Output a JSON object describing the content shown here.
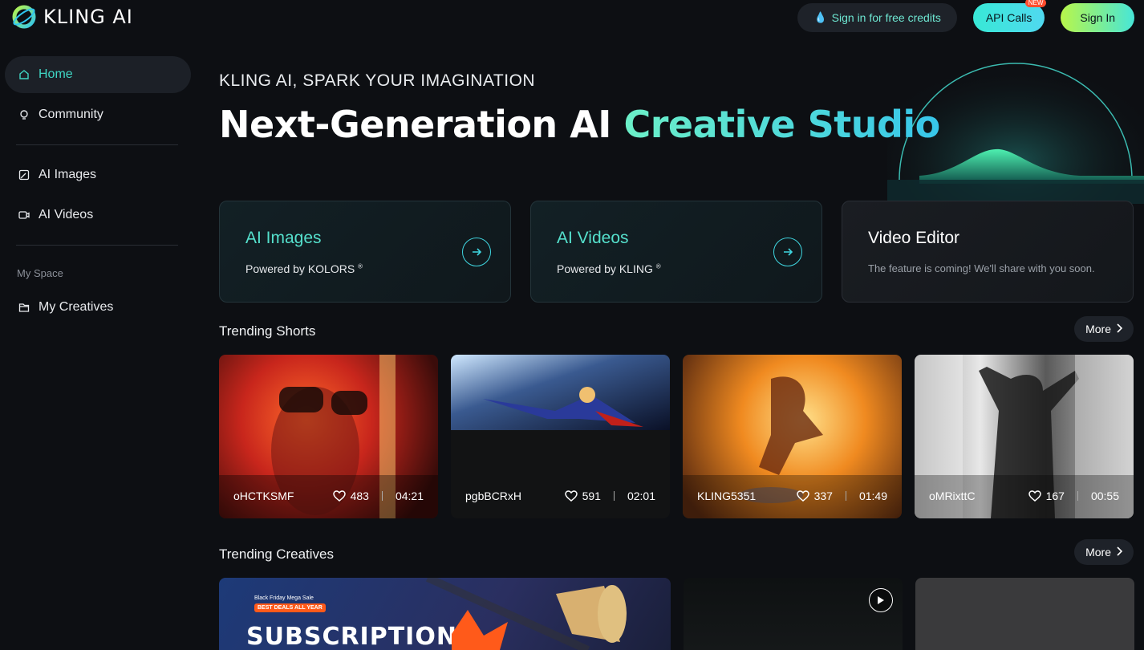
{
  "brand": {
    "name": "KLING AI",
    "accent": "#3fd6c4"
  },
  "header": {
    "credits_label": "Sign in for free credits",
    "api_label": "API Calls",
    "api_badge": "NEW",
    "signin_label": "Sign In"
  },
  "sidebar": {
    "items": [
      {
        "label": "Home",
        "icon": "home-icon",
        "active": true
      },
      {
        "label": "Community",
        "icon": "bulb-icon"
      },
      {
        "label": "AI Images",
        "icon": "image-icon"
      },
      {
        "label": "AI Videos",
        "icon": "video-icon"
      }
    ],
    "section_label": "My Space",
    "my_creatives": {
      "label": "My Creatives",
      "icon": "folder-icon"
    }
  },
  "hero": {
    "subtitle": "KLING AI, SPARK YOUR IMAGINATION",
    "title_plain": "Next-Generation AI ",
    "title_highlight": "Creative Studio"
  },
  "cards": [
    {
      "title": "AI Images",
      "subtitle": "Powered by KOLORS",
      "mark": "®"
    },
    {
      "title": "AI Videos",
      "subtitle": "Powered by KLING",
      "mark": "®"
    },
    {
      "title": "Video Editor",
      "subtitle": "The feature is coming! We'll share with you soon."
    }
  ],
  "trending_shorts": {
    "title": "Trending Shorts",
    "more_label": "More",
    "items": [
      {
        "author": "oHCTKSMF",
        "likes": "483",
        "duration": "04:21"
      },
      {
        "author": "pgbBCRxH",
        "likes": "591",
        "duration": "02:01"
      },
      {
        "author": "KLING5351",
        "likes": "337",
        "duration": "01:49"
      },
      {
        "author": "oMRixttC",
        "likes": "167",
        "duration": "00:55"
      }
    ]
  },
  "trending_creatives": {
    "title": "Trending Creatives",
    "more_label": "More",
    "promo": {
      "tag": "Black Friday Mega Sale",
      "badge": "BEST DEALS ALL YEAR",
      "headline": "SUBSCRIPTION"
    }
  }
}
